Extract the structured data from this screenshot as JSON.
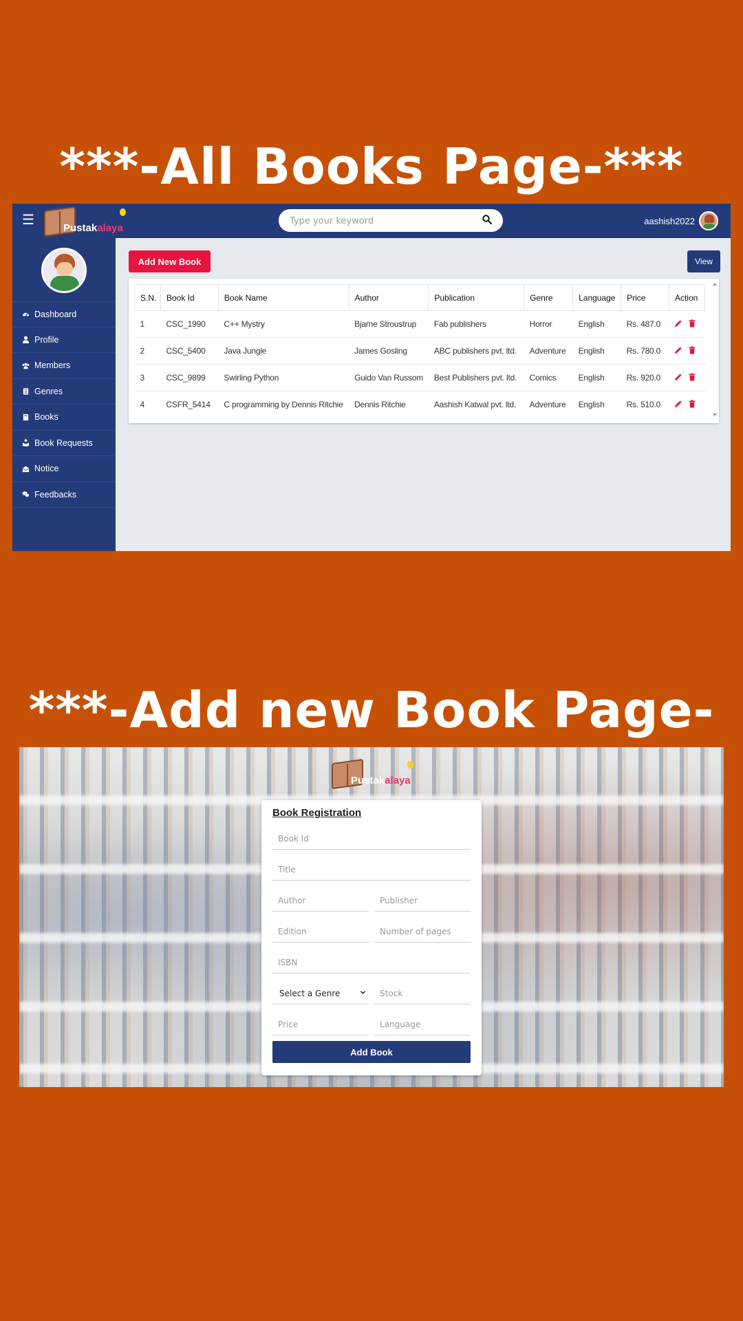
{
  "banners": {
    "all_books": "***-All Books Page-***",
    "add_book": "***-Add new Book Page-***"
  },
  "colors": {
    "brand_navy": "#243b79",
    "accent_red": "#e8143e",
    "page_bg": "#c65106"
  },
  "logo": {
    "part1": "Pustak",
    "part2": "alaya"
  },
  "topbar": {
    "search_placeholder": "Type your keyword",
    "username": "aashish2022"
  },
  "sidebar": {
    "items": [
      {
        "label": "Dashboard",
        "icon": "dashboard-icon"
      },
      {
        "label": "Profile",
        "icon": "user-icon"
      },
      {
        "label": "Members",
        "icon": "users-icon"
      },
      {
        "label": "Genres",
        "icon": "clipboard-icon"
      },
      {
        "label": "Books",
        "icon": "book-icon"
      },
      {
        "label": "Book Requests",
        "icon": "book-reader-icon"
      },
      {
        "label": "Notice",
        "icon": "envelope-icon"
      },
      {
        "label": "Feedbacks",
        "icon": "comments-icon"
      }
    ]
  },
  "actions": {
    "add_new_book": "Add New Book",
    "view": "View"
  },
  "table": {
    "headers": [
      "S.N.",
      "Book Id",
      "Book Name",
      "Author",
      "Publication",
      "Genre",
      "Language",
      "Price",
      "Action"
    ],
    "rows": [
      [
        "1",
        "CSC_1990",
        "C++ Mystry",
        "Bjarne Stroustrup",
        "Fab publishers",
        "Horror",
        "English",
        "Rs. 487.0"
      ],
      [
        "2",
        "CSC_5400",
        "Java Jungle",
        "James Gosling",
        "ABC publishers pvt. ltd.",
        "Adventure",
        "English",
        "Rs. 780.0"
      ],
      [
        "3",
        "CSC_9899",
        "Swirling Python",
        "Guido Van Russom",
        "Best Publishers pvt. ltd.",
        "Comics",
        "English",
        "Rs. 920.0"
      ],
      [
        "4",
        "CSFR_5414",
        "C programming by Dennis Ritchie",
        "Dennis Ritchie",
        "Aashish Katwal pvt. ltd.",
        "Adventure",
        "English",
        "Rs. 510.0"
      ]
    ]
  },
  "form": {
    "title": "Book Registration",
    "book_id": "Book Id",
    "title_ph": "Title",
    "author": "Author",
    "publisher": "Publisher",
    "edition": "Edition",
    "pages": "Number of pages",
    "isbn": "ISBN",
    "genre_select": "Select a Genre",
    "stock": "Stock",
    "price": "Price",
    "language": "Language",
    "submit": "Add Book"
  }
}
